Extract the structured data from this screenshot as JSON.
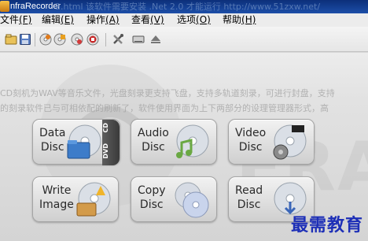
{
  "window": {
    "title": "nfraRecorder",
    "overlay_text": "2.html 该软件需要安装 .Net 2.0 才能运行 http://www.51zxw.net/"
  },
  "menu": [
    {
      "label": "文件",
      "key": "(F)"
    },
    {
      "label": "编辑",
      "key": "(E)"
    },
    {
      "label": "操作",
      "key": "(A)"
    },
    {
      "label": "查看",
      "key": "(V)"
    },
    {
      "label": "选项",
      "key": "(O)"
    },
    {
      "label": "帮助",
      "key": "(H)"
    }
  ],
  "toolbar": {
    "buttons": [
      {
        "name": "open-icon"
      },
      {
        "name": "save-icon"
      },
      {
        "name": "record-disc-icon"
      },
      {
        "name": "copy-disc-icon"
      },
      {
        "name": "erase-disc-icon"
      },
      {
        "name": "stop-icon"
      },
      {
        "name": "settings-tools-icon"
      },
      {
        "name": "drive-icon"
      },
      {
        "name": "eject-icon"
      }
    ]
  },
  "content": {
    "description_line1": "CD刻机为WAV等音乐文件，光盘刻录更支持飞盘，支持多轨道刻录，可进行封盘，支持",
    "description_line2": "的刻录软件已与可相依配的刷新了，软件使用界面为上下两部分的设理管理器形式，高",
    "background_text": "FRA"
  },
  "actions": [
    {
      "line1": "Data",
      "line2": "Disc",
      "icon": "data-disc-icon",
      "tab_top": "CD",
      "tab_bottom": "DVD"
    },
    {
      "line1": "Audio",
      "line2": "Disc",
      "icon": "audio-disc-icon"
    },
    {
      "line1": "Video",
      "line2": "Disc",
      "icon": "video-disc-icon"
    },
    {
      "line1": "Write",
      "line2": "Image",
      "icon": "write-image-icon"
    },
    {
      "line1": "Copy",
      "line2": "Disc",
      "icon": "copy-disc-icon"
    },
    {
      "line1": "Read",
      "line2": "Disc",
      "icon": "read-disc-icon"
    }
  ],
  "brand": "最需教育",
  "colors": {
    "titlebar": "#1c4ea8",
    "brand_text": "#1d2fb7",
    "button_text": "#2a2a2a"
  }
}
